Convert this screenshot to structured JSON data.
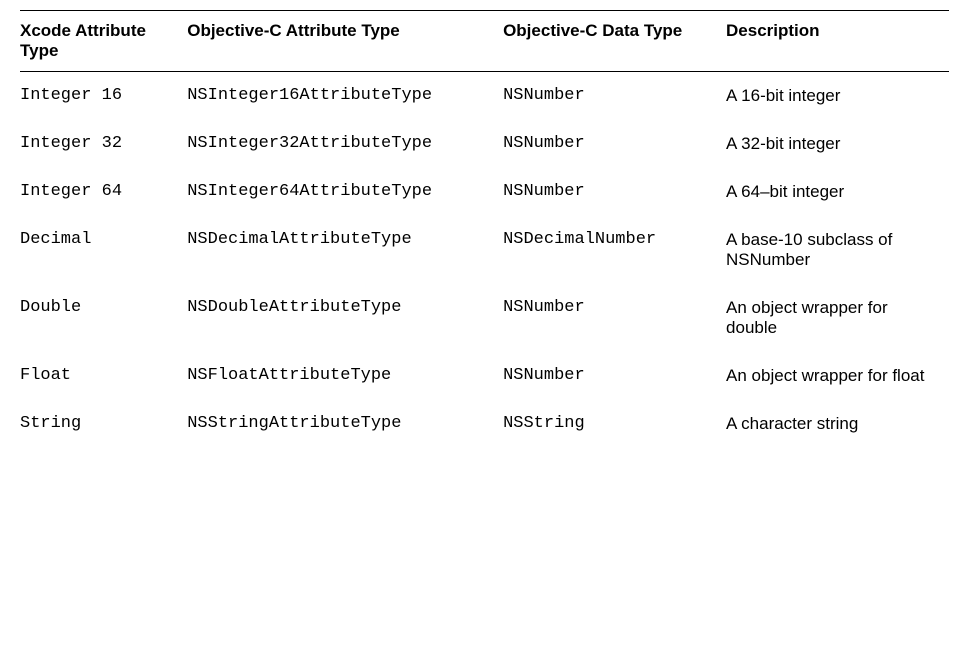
{
  "table": {
    "headers": {
      "h1": "Xcode Attribute Type",
      "h2": "Objective-C Attribute Type",
      "h3": "Objective-C Data Type",
      "h4": "Description"
    },
    "rows": [
      {
        "xcode": "Integer 16",
        "attrType": "NSInteger16AttributeType",
        "dataType": "NSNumber",
        "desc": "A 16-bit integer"
      },
      {
        "xcode": "Integer 32",
        "attrType": "NSInteger32AttributeType",
        "dataType": "NSNumber",
        "desc": "A 32-bit integer"
      },
      {
        "xcode": "Integer 64",
        "attrType": "NSInteger64AttributeType",
        "dataType": "NSNumber",
        "desc": "A 64–bit integer"
      },
      {
        "xcode": "Decimal",
        "attrType": "NSDecimalAttributeType",
        "dataType": "NSDecimalNumber",
        "desc": "A base-10 subclass of NSNumber"
      },
      {
        "xcode": "Double",
        "attrType": "NSDoubleAttributeType",
        "dataType": "NSNumber",
        "desc": "An object wrapper for double"
      },
      {
        "xcode": "Float",
        "attrType": "NSFloatAttributeType",
        "dataType": "NSNumber",
        "desc": "An object wrapper for float"
      },
      {
        "xcode": "String",
        "attrType": "NSStringAttributeType",
        "dataType": "NSString",
        "desc": "A character string"
      }
    ]
  }
}
